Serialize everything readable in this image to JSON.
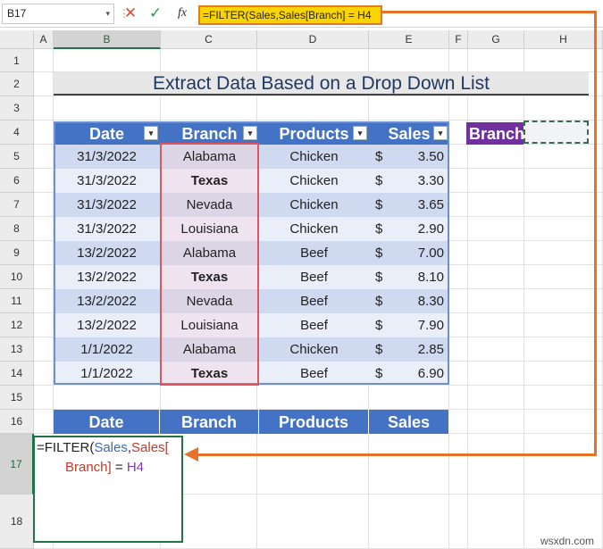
{
  "formula_bar": {
    "name_box": "B17",
    "formula": "=FILTER(Sales,Sales[Branch] = H4"
  },
  "icons": {
    "cancel": "✕",
    "enter": "✓",
    "fx": "fx",
    "dropdown": "▾"
  },
  "columns": [
    "A",
    "B",
    "C",
    "D",
    "E",
    "F",
    "G",
    "H"
  ],
  "rows": [
    "1",
    "2",
    "3",
    "4",
    "5",
    "6",
    "7",
    "8",
    "9",
    "10",
    "11",
    "12",
    "13",
    "14",
    "15",
    "16",
    "17",
    "18"
  ],
  "title": "Extract Data Based on a Drop Down List",
  "table": {
    "headers": [
      "Date",
      "Branch",
      "Products",
      "Sales"
    ],
    "rows": [
      {
        "date": "31/3/2022",
        "branch": "Alabama",
        "product": "Chicken",
        "sales": "3.50"
      },
      {
        "date": "31/3/2022",
        "branch": "Texas",
        "product": "Chicken",
        "sales": "3.30"
      },
      {
        "date": "31/3/2022",
        "branch": "Nevada",
        "product": "Chicken",
        "sales": "3.65"
      },
      {
        "date": "31/3/2022",
        "branch": "Louisiana",
        "product": "Chicken",
        "sales": "2.90"
      },
      {
        "date": "13/2/2022",
        "branch": "Alabama",
        "product": "Beef",
        "sales": "7.00"
      },
      {
        "date": "13/2/2022",
        "branch": "Texas",
        "product": "Beef",
        "sales": "8.10"
      },
      {
        "date": "13/2/2022",
        "branch": "Nevada",
        "product": "Beef",
        "sales": "8.30"
      },
      {
        "date": "13/2/2022",
        "branch": "Louisiana",
        "product": "Beef",
        "sales": "7.90"
      },
      {
        "date": "1/1/2022",
        "branch": "Alabama",
        "product": "Chicken",
        "sales": "2.85"
      },
      {
        "date": "1/1/2022",
        "branch": "Texas",
        "product": "Beef",
        "sales": "6.90"
      }
    ],
    "currency": "$"
  },
  "branch_selector": {
    "label": "Branch",
    "value": ""
  },
  "output_table": {
    "headers": [
      "Date",
      "Branch",
      "Products",
      "Sales"
    ]
  },
  "edit_cell": {
    "part1": "=FILTER(",
    "ref_sales": "Sales",
    "comma": ",",
    "ref_sales_branch_a": "Sales[",
    "ref_sales_branch_b": "Branch]",
    "eq": " = ",
    "ref_h4": "H4"
  },
  "watermark": "wsxdn.com",
  "colors": {
    "table_header": "#4472c4",
    "branch_label": "#7030a0",
    "callout": "#e8712a",
    "formula_highlight": "#f9d400"
  }
}
